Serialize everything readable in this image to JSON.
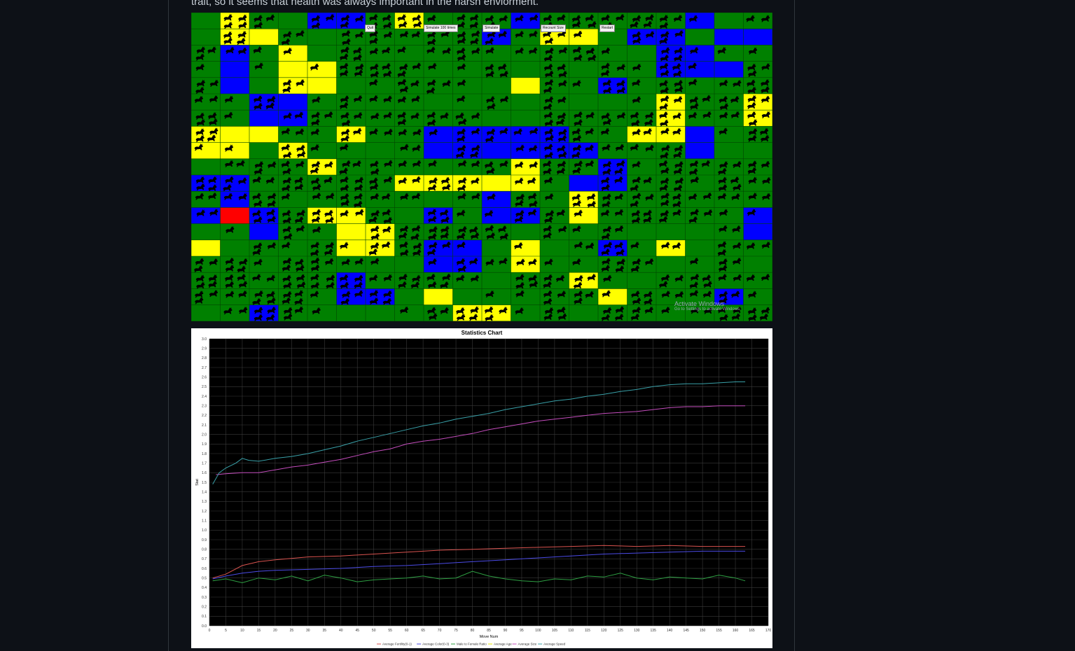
{
  "article": {
    "intro_text": "trait, so it seems that health was always important in the harsh enviorment."
  },
  "simulation": {
    "cols": 20,
    "rows": 19,
    "colors": {
      "grass": "#008000",
      "sand": "#ffff00",
      "water": "#0000ff",
      "selected": "#ff0000",
      "rabbit": "#000000",
      "gridline": "#004400"
    },
    "toolbar_buttons": [
      {
        "label": "Quit"
      },
      {
        "label": "Simulate 100 times"
      },
      {
        "label": "Simulate"
      },
      {
        "label": "Recount Size"
      },
      {
        "label": "Restart"
      }
    ],
    "watermark": {
      "title": "Activate Windows",
      "subtitle": "Go to Settings to activate Windows."
    }
  },
  "chart_data": {
    "type": "line",
    "title": "Statistics Chart",
    "xlabel": "Move Num",
    "ylabel": "Stat",
    "xlim": [
      0,
      170
    ],
    "ylim": [
      0,
      3.0
    ],
    "x_ticks": [
      0,
      5,
      10,
      15,
      20,
      25,
      30,
      35,
      40,
      45,
      50,
      55,
      60,
      65,
      70,
      75,
      80,
      85,
      90,
      95,
      100,
      105,
      110,
      115,
      120,
      125,
      130,
      135,
      140,
      145,
      150,
      155,
      160,
      165,
      170
    ],
    "y_ticks": [
      0.0,
      0.1,
      0.2,
      0.3,
      0.4,
      0.5,
      0.6,
      0.7,
      0.8,
      0.9,
      1.0,
      1.1,
      1.2,
      1.3,
      1.4,
      1.5,
      1.6,
      1.7,
      1.8,
      1.9,
      2.0,
      2.1,
      2.2,
      2.3,
      2.4,
      2.5,
      2.6,
      2.7,
      2.8,
      2.9,
      3.0
    ],
    "grid": true,
    "legend_position": "bottom",
    "background": "#000000",
    "series": [
      {
        "name": "Average Fertility(0-1)",
        "color": "#d9534f",
        "x": [
          1,
          5,
          10,
          15,
          20,
          30,
          40,
          50,
          60,
          70,
          80,
          90,
          100,
          110,
          120,
          130,
          140,
          150,
          160,
          163
        ],
        "values": [
          0.5,
          0.54,
          0.63,
          0.67,
          0.69,
          0.72,
          0.73,
          0.75,
          0.77,
          0.79,
          0.8,
          0.81,
          0.82,
          0.83,
          0.84,
          0.83,
          0.84,
          0.83,
          0.83,
          0.83
        ]
      },
      {
        "name": "Average Color(0-3)",
        "color": "#4b4be6",
        "x": [
          1,
          5,
          10,
          15,
          20,
          30,
          40,
          50,
          60,
          70,
          80,
          90,
          100,
          110,
          120,
          130,
          140,
          150,
          160,
          163
        ],
        "values": [
          0.49,
          0.52,
          0.55,
          0.57,
          0.58,
          0.59,
          0.6,
          0.62,
          0.63,
          0.65,
          0.67,
          0.69,
          0.71,
          0.73,
          0.75,
          0.76,
          0.77,
          0.78,
          0.78,
          0.78
        ]
      },
      {
        "name": "Male to Female Ratio",
        "color": "#2ea043",
        "x": [
          1,
          5,
          10,
          15,
          20,
          25,
          30,
          35,
          40,
          45,
          50,
          55,
          60,
          65,
          70,
          75,
          80,
          85,
          90,
          95,
          100,
          105,
          110,
          115,
          120,
          125,
          130,
          135,
          140,
          145,
          150,
          155,
          160,
          163
        ],
        "values": [
          0.47,
          0.49,
          0.45,
          0.5,
          0.48,
          0.52,
          0.47,
          0.53,
          0.5,
          0.46,
          0.48,
          0.49,
          0.5,
          0.52,
          0.49,
          0.5,
          0.57,
          0.52,
          0.49,
          0.47,
          0.46,
          0.49,
          0.48,
          0.52,
          0.51,
          0.55,
          0.5,
          0.48,
          0.51,
          0.5,
          0.49,
          0.53,
          0.5,
          0.47
        ]
      },
      {
        "name": "Average Age",
        "color": "#e3e300",
        "x": [],
        "values": []
      },
      {
        "name": "Average Size",
        "color": "#c44dbd",
        "x": [
          2,
          5,
          10,
          15,
          20,
          25,
          30,
          35,
          40,
          45,
          50,
          55,
          60,
          65,
          70,
          75,
          80,
          85,
          90,
          95,
          100,
          105,
          110,
          115,
          120,
          125,
          130,
          135,
          140,
          145,
          150,
          155,
          160,
          163
        ],
        "values": [
          1.58,
          1.59,
          1.6,
          1.6,
          1.63,
          1.66,
          1.68,
          1.71,
          1.74,
          1.78,
          1.82,
          1.85,
          1.9,
          1.93,
          1.95,
          1.98,
          2.01,
          2.05,
          2.08,
          2.11,
          2.14,
          2.16,
          2.18,
          2.2,
          2.22,
          2.23,
          2.24,
          2.26,
          2.28,
          2.29,
          2.29,
          2.3,
          2.3,
          2.3
        ]
      },
      {
        "name": "Average Speed",
        "color": "#39a0a8",
        "x": [
          1,
          3,
          5,
          8,
          10,
          12,
          15,
          20,
          25,
          30,
          35,
          40,
          45,
          50,
          55,
          60,
          65,
          70,
          75,
          80,
          85,
          90,
          95,
          100,
          105,
          110,
          115,
          120,
          125,
          130,
          135,
          140,
          145,
          150,
          155,
          160,
          163
        ],
        "values": [
          1.48,
          1.6,
          1.65,
          1.7,
          1.75,
          1.73,
          1.72,
          1.75,
          1.77,
          1.8,
          1.84,
          1.88,
          1.93,
          1.97,
          2.01,
          2.05,
          2.09,
          2.12,
          2.16,
          2.19,
          2.22,
          2.26,
          2.29,
          2.32,
          2.35,
          2.37,
          2.4,
          2.42,
          2.45,
          2.47,
          2.5,
          2.52,
          2.53,
          2.53,
          2.54,
          2.55,
          2.55
        ]
      }
    ]
  }
}
